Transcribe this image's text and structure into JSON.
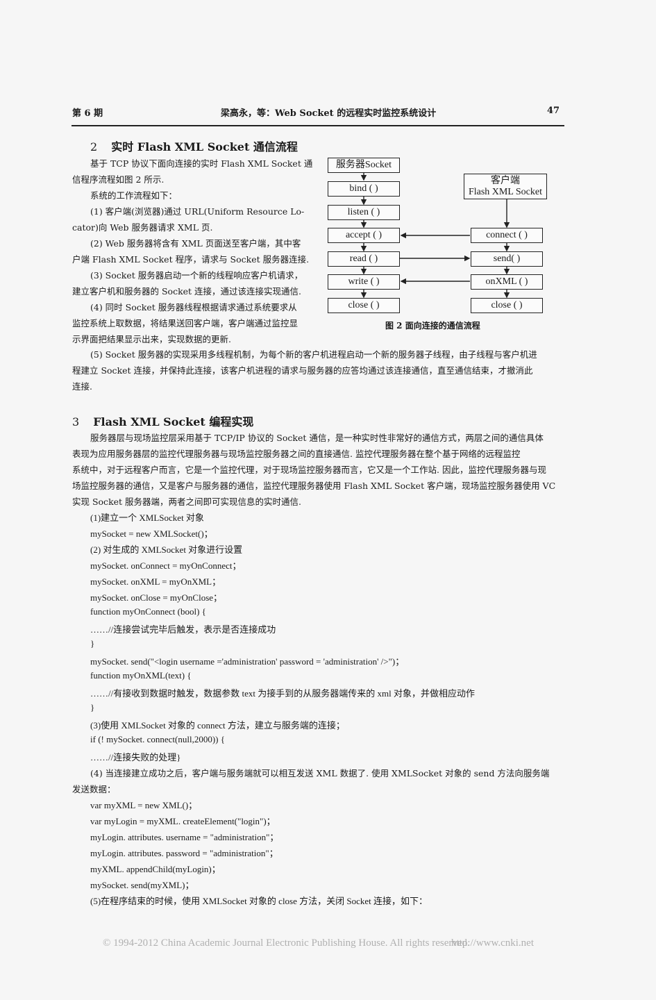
{
  "running_head": {
    "issue": "第 6 期",
    "title": "梁高永，等：Web Socket 的远程实时监控系统设计",
    "page_number": "47"
  },
  "section2": {
    "number": "2",
    "title": "实时 Flash XML Socket 通信流程",
    "lines": [
      "基于 TCP 协议下面向连接的实时 Flash XML Socket 通",
      "信程序流程如图 2 所示.",
      "系统的工作流程如下：",
      "(1) 客户端(浏览器)通过 URL(Uniform Resource Lo-",
      "cator)向 Web 服务器请求 XML 页.",
      "(2) Web 服务器将含有 XML 页面送至客户端，其中客",
      "户端 Flash XML Socket 程序，请求与 Socket 服务器连接.",
      "(3) Socket 服务器启动一个新的线程响应客户机请求，",
      "建立客户机和服务器的 Socket 连接，通过该连接实现通信.",
      "(4) 同时 Socket 服务器线程根据请求通过系统要求从",
      "监控系统上取数据，将结果送回客户端，客户端通过监控显",
      "示界面把结果显示出来，实现数据的更新."
    ],
    "full_lines": [
      "(5) Socket 服务器的实现采用多线程机制，为每个新的客户机进程启动一个新的服务器子线程，由子线程与客户机进",
      "程建立 Socket 连接，并保持此连接，该客户机进程的请求与服务器的应答均通过该连接通信，直至通信结束，才撤消此",
      "连接."
    ]
  },
  "figure2": {
    "server_column": [
      "服务器Socket",
      "bind ( )",
      "listen ( )",
      "accept ( )",
      "read ( )",
      "write ( )",
      "close ( )"
    ],
    "client_title_line1": "客户端",
    "client_title_line2": "Flash XML Socket",
    "client_column": [
      "connect ( )",
      "send( )",
      "onXML ( )",
      "close ( )"
    ],
    "caption": "图 2    面向连接的通信流程"
  },
  "section3": {
    "number": "3",
    "title": "Flash XML Socket 编程实现",
    "lines": [
      "服务器层与现场监控层采用基于 TCP/IP 协议的 Socket 通信，是一种实时性非常好的通信方式，两层之间的通信具体",
      "表现为应用服务器层的监控代理服务器与现场监控服务器之间的直接通信. 监控代理服务器在整个基于网络的远程监控",
      "系统中，对于远程客户而言，它是一个监控代理，对于现场监控服务器而言，它又是一个工作站. 因此，监控代理服务器与现",
      "场监控服务器的通信，又是客户与服务器的通信，监控代理服务器使用 Flash XML Socket 客户端，现场监控服务器使用 VC",
      "实现 Socket 服务器端，两者之间即可实现信息的实时通信."
    ],
    "code_lines": [
      "(1)建立一个 XMLSocket 对象",
      "mySocket = new XMLSocket()；",
      "(2) 对生成的 XMLSocket 对象进行设置",
      "mySocket. onConnect = myOnConnect；",
      "mySocket. onXML = myOnXML；",
      "mySocket. onClose = myOnClose；",
      "function myOnConnect (bool) {",
      "……//连接尝试完毕后触发，表示是否连接成功",
      "}",
      "mySocket. send(\"<login username ='administration' password = 'administration' />\")；",
      "function myOnXML(text) {",
      "……//有接收到数据时触发，数据参数 text 为接手到的从服务器端传来的 xml 对象，并做相应动作",
      "}",
      "(3)使用 XMLSocket 对象的 connect 方法，建立与服务端的连接；",
      "if (! mySocket. connect(null,2000)) {",
      "……//连接失败的处理}"
    ],
    "step4_lines": [
      "(4) 当连接建立成功之后，客户端与服务端就可以相互发送 XML 数据了. 使用 XMLSocket 对象的 send 方法向服务端",
      "发送数据："
    ],
    "code_lines2": [
      "var myXML = new XML()；",
      "var myLogin = myXML. createElement(\"login\")；",
      "myLogin. attributes. username = \"administration\"；",
      "myLogin. attributes. password = \"administration\"；",
      "myXML. appendChild(myLogin)；",
      "mySocket. send(myXML)；",
      "(5)在程序结束的时候，使用 XMLSocket 对象的 close 方法，关闭 Socket 连接，如下："
    ]
  },
  "footer": {
    "copyright": "© 1994-2012 China Academic Journal Electronic Publishing House. All rights reserved.",
    "url": "http://www.cnki.net"
  }
}
